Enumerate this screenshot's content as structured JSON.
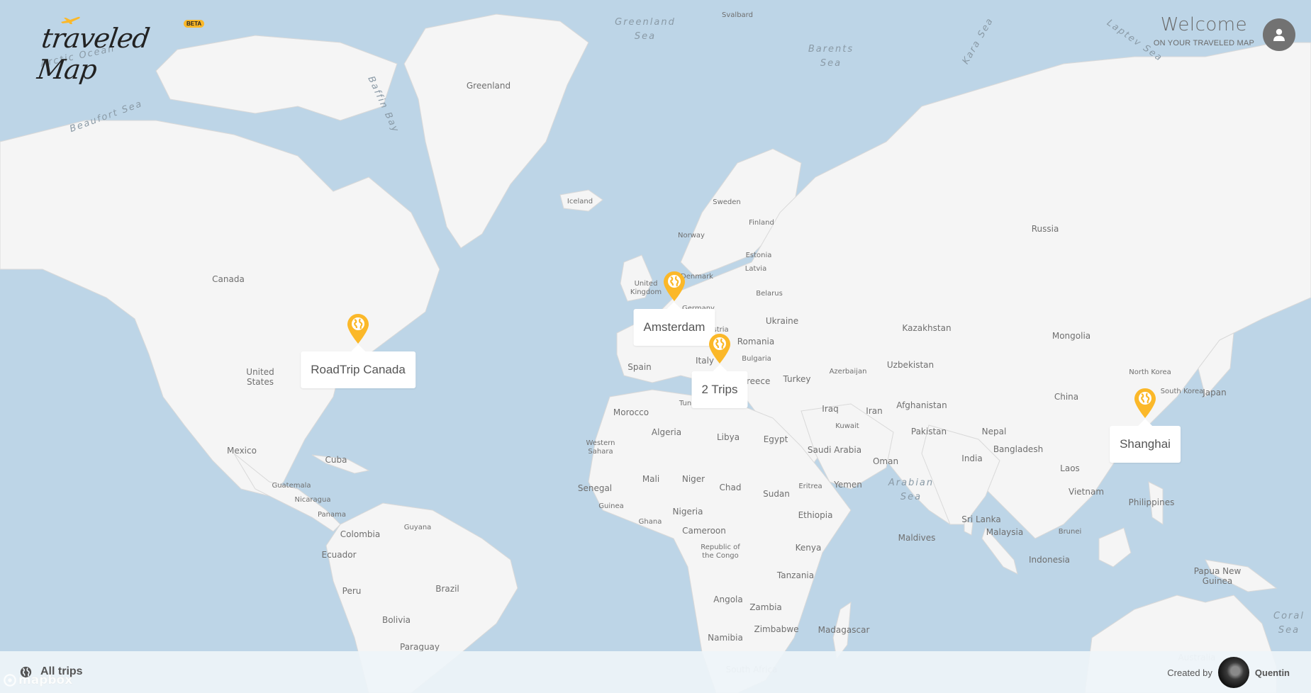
{
  "header": {
    "logo_text": "traveled Map",
    "beta_badge": "BETA",
    "welcome_title": "Welcome",
    "welcome_subtitle": "ON YOUR TRAVELED MAP",
    "user_icon": "user-icon"
  },
  "colors": {
    "accent": "#fbb829",
    "water": "#bdd5e7",
    "land": "#f5f5f5",
    "text": "#555555"
  },
  "trips": [
    {
      "label": "RoadTrip Canada",
      "icon": "globe-pin-icon"
    },
    {
      "label": "Amsterdam",
      "icon": "globe-pin-icon"
    },
    {
      "label": "2 Trips",
      "icon": "globe-pin-icon"
    },
    {
      "label": "Shanghai",
      "icon": "globe-pin-icon"
    }
  ],
  "footer": {
    "all_trips_label": "All trips",
    "all_trips_icon": "globe-icon",
    "created_by_label": "Created by",
    "creator_name": "Quentin",
    "attribution": "mapbox"
  },
  "map_labels": {
    "oceans": [
      "Arctic Ocean",
      "Greenland Sea",
      "Barents Sea",
      "Kara Sea",
      "Laptev Sea",
      "Beaufort Sea",
      "Baffin Bay",
      "Arabian Sea",
      "Coral Sea"
    ],
    "countries": [
      "Greenland",
      "Svalbard",
      "Iceland",
      "Canada",
      "United States",
      "Mexico",
      "Cuba",
      "Guatemala",
      "Nicaragua",
      "Panama",
      "Colombia",
      "Guyana",
      "Ecuador",
      "Peru",
      "Brazil",
      "Bolivia",
      "Paraguay",
      "Sweden",
      "Norway",
      "Finland",
      "Estonia",
      "Latvia",
      "United Kingdom",
      "Denmark",
      "Germany",
      "Belarus",
      "Ukraine",
      "Austria",
      "Romania",
      "Bulgaria",
      "Italy",
      "Spain",
      "Greece",
      "Turkey",
      "Tunisia",
      "Morocco",
      "Algeria",
      "Libya",
      "Egypt",
      "Western Sahara",
      "Mali",
      "Niger",
      "Chad",
      "Sudan",
      "Senegal",
      "Guinea",
      "Ghana",
      "Nigeria",
      "Cameroon",
      "Republic of the Congo",
      "Ethiopia",
      "Eritrea",
      "Kenya",
      "Tanzania",
      "Angola",
      "Zambia",
      "Zimbabwe",
      "Namibia",
      "South Africa",
      "Madagascar",
      "Russia",
      "Kazakhstan",
      "Mongolia",
      "Uzbekistan",
      "Azerbaijan",
      "Iraq",
      "Iran",
      "Kuwait",
      "Afghanistan",
      "Pakistan",
      "Saudi Arabia",
      "Oman",
      "Yemen",
      "Nepal",
      "India",
      "Bangladesh",
      "China",
      "North Korea",
      "South Korea",
      "Japan",
      "Laos",
      "Vietnam",
      "Philippines",
      "Sri Lanka",
      "Maldives",
      "Malaysia",
      "Brunei",
      "Indonesia",
      "Papua New Guinea",
      "Australia"
    ]
  }
}
